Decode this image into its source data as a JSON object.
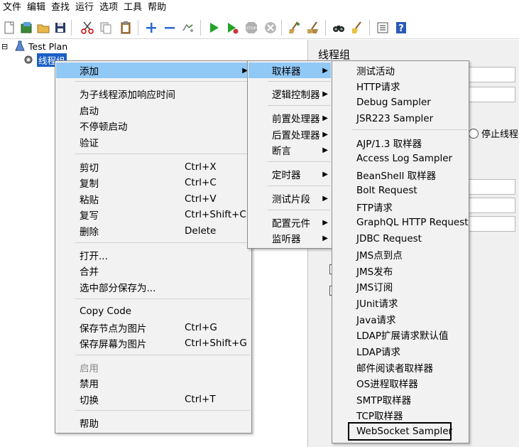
{
  "menubar": [
    "文件",
    "编辑",
    "查找",
    "运行",
    "选项",
    "工具",
    "帮助"
  ],
  "tree": {
    "plan_label": "Test Plan",
    "group_label": "线程组",
    "collapse_symbol": "⊟"
  },
  "right_panel": {
    "title": "线程组",
    "stop_thread_label": "停止线程"
  },
  "context_menu": {
    "add": "添加",
    "items": [
      {
        "label": "为子线程添加响应时间"
      },
      {
        "label": "启动"
      },
      {
        "label": "不停顿启动"
      },
      {
        "label": "验证"
      },
      {
        "label": "剪切",
        "shortcut": "Ctrl+X"
      },
      {
        "label": "复制",
        "shortcut": "Ctrl+C"
      },
      {
        "label": "粘贴",
        "shortcut": "Ctrl+V"
      },
      {
        "label": "复写",
        "shortcut": "Ctrl+Shift+C"
      },
      {
        "label": "删除",
        "shortcut": "Delete"
      },
      {
        "label": "打开..."
      },
      {
        "label": "合并"
      },
      {
        "label": "选中部分保存为..."
      },
      {
        "label": "Copy Code"
      },
      {
        "label": "保存节点为图片",
        "shortcut": "Ctrl+G"
      },
      {
        "label": "保存屏幕为图片",
        "shortcut": "Ctrl+Shift+G"
      },
      {
        "label": "启用",
        "disabled": true
      },
      {
        "label": "禁用"
      },
      {
        "label": "切换",
        "shortcut": "Ctrl+T"
      },
      {
        "label": "帮助"
      }
    ]
  },
  "add_submenu": [
    "取样器",
    "逻辑控制器",
    "前置处理器",
    "后置处理器",
    "断言",
    "定时器",
    "测试片段",
    "配置元件",
    "监听器"
  ],
  "sampler_submenu": [
    "测试活动",
    "HTTP请求",
    "Debug Sampler",
    "JSR223 Sampler",
    "AJP/1.3 取样器",
    "Access Log Sampler",
    "BeanShell 取样器",
    "Bolt Request",
    "FTP请求",
    "GraphQL HTTP Request",
    "JDBC Request",
    "JMS点到点",
    "JMS发布",
    "JMS订阅",
    "JUnit请求",
    "Java请求",
    "LDAP扩展请求默认值",
    "LDAP请求",
    "邮件阅读者取样器",
    "OS进程取样器",
    "SMTP取样器",
    "TCP取样器",
    "WebSocket Sampler"
  ],
  "toolbar_icons": [
    "new-icon",
    "templates-icon",
    "open-icon",
    "save-icon",
    "cut-icon",
    "copy-icon",
    "paste-icon",
    "expand-icon",
    "collapse-icon",
    "toggle-icon",
    "start-icon",
    "start-no-pause-icon",
    "stop-icon",
    "shutdown-icon",
    "clear-icon",
    "clear-all-icon",
    "search-icon",
    "reset-search-icon",
    "function-helper-icon",
    "help-icon"
  ]
}
